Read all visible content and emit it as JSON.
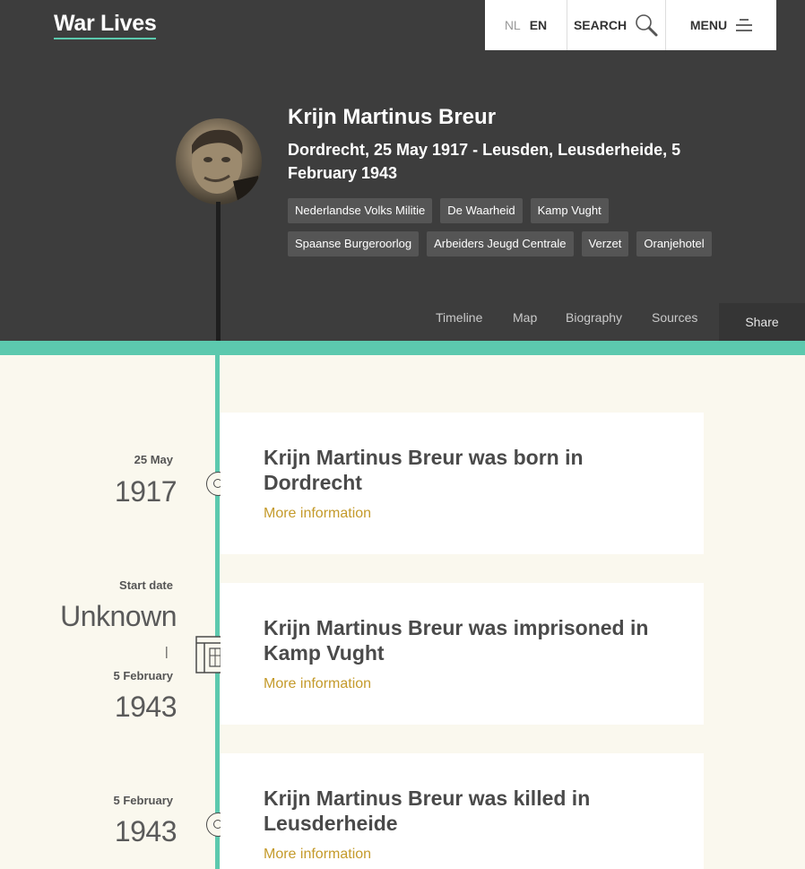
{
  "header": {
    "logo": "War Lives",
    "lang_nl": "NL",
    "lang_en": "EN",
    "search_label": "SEARCH",
    "menu_label": "MENU"
  },
  "person": {
    "name": "Krijn Martinus Breur",
    "dates": "Dordrecht, 25 May 1917 - Leusden, Leusderheide, 5 February 1943",
    "tags": [
      "Nederlandse Volks Militie",
      "De Waarheid",
      "Kamp Vught",
      "Spaanse Burgeroorlog",
      "Arbeiders Jeugd Centrale",
      "Verzet",
      "Oranjehotel"
    ]
  },
  "nav": {
    "timeline": "Timeline",
    "map": "Map",
    "biography": "Biography",
    "sources": "Sources",
    "share": "Share"
  },
  "colors": {
    "hero_bg": "#3d3d3d",
    "accent": "#5cc9ae",
    "link": "#c49a2a",
    "page_bg": "#faf8ee"
  },
  "events": [
    {
      "date_label": "25 May",
      "year": "1917",
      "title": "Krijn Martinus Breur was born in Dordrecht",
      "more": "More information",
      "icon": "circle-marker-icon"
    },
    {
      "date_label": "Start date",
      "year": "Unknown",
      "separator": "|",
      "end_label": "5 February",
      "end_year": "1943",
      "title": "Krijn Martinus Breur was imprisoned in Kamp Vught",
      "more": "More information",
      "icon": "prison-icon"
    },
    {
      "date_label": "5 February",
      "year": "1943",
      "title": "Krijn Martinus Breur was killed in Leusderheide",
      "more": "More information",
      "icon": "circle-marker-icon"
    }
  ]
}
